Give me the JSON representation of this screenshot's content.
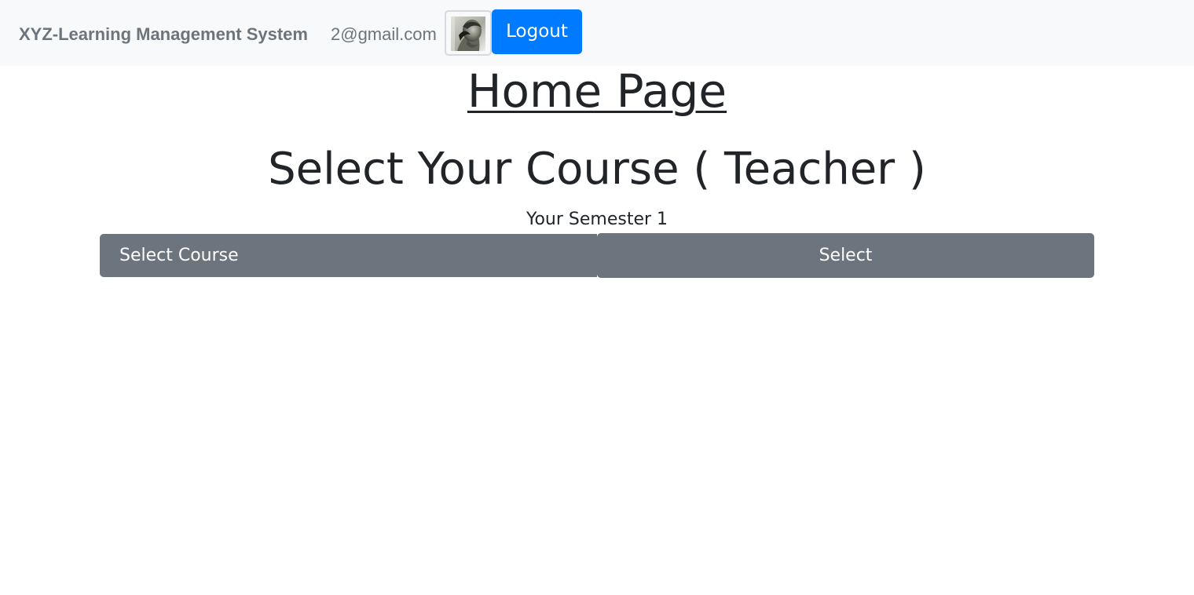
{
  "navbar": {
    "brand": "XYZ-Learning Management System",
    "email": "2@gmail.com",
    "avatar_icon": "profile-photo",
    "logout_label": "Logout"
  },
  "main": {
    "home_title": "Home Page",
    "course_heading": "Select Your Course ( Teacher )",
    "semester_text": "Your Semester 1",
    "course_select": {
      "selected_value": "Select Course"
    },
    "select_button_label": "Select"
  },
  "colors": {
    "navbar_background": "#f8f9fa",
    "muted_text": "#6c757d",
    "primary_button": "#007bff",
    "secondary_button": "#6c757d",
    "body_text": "#212529"
  }
}
